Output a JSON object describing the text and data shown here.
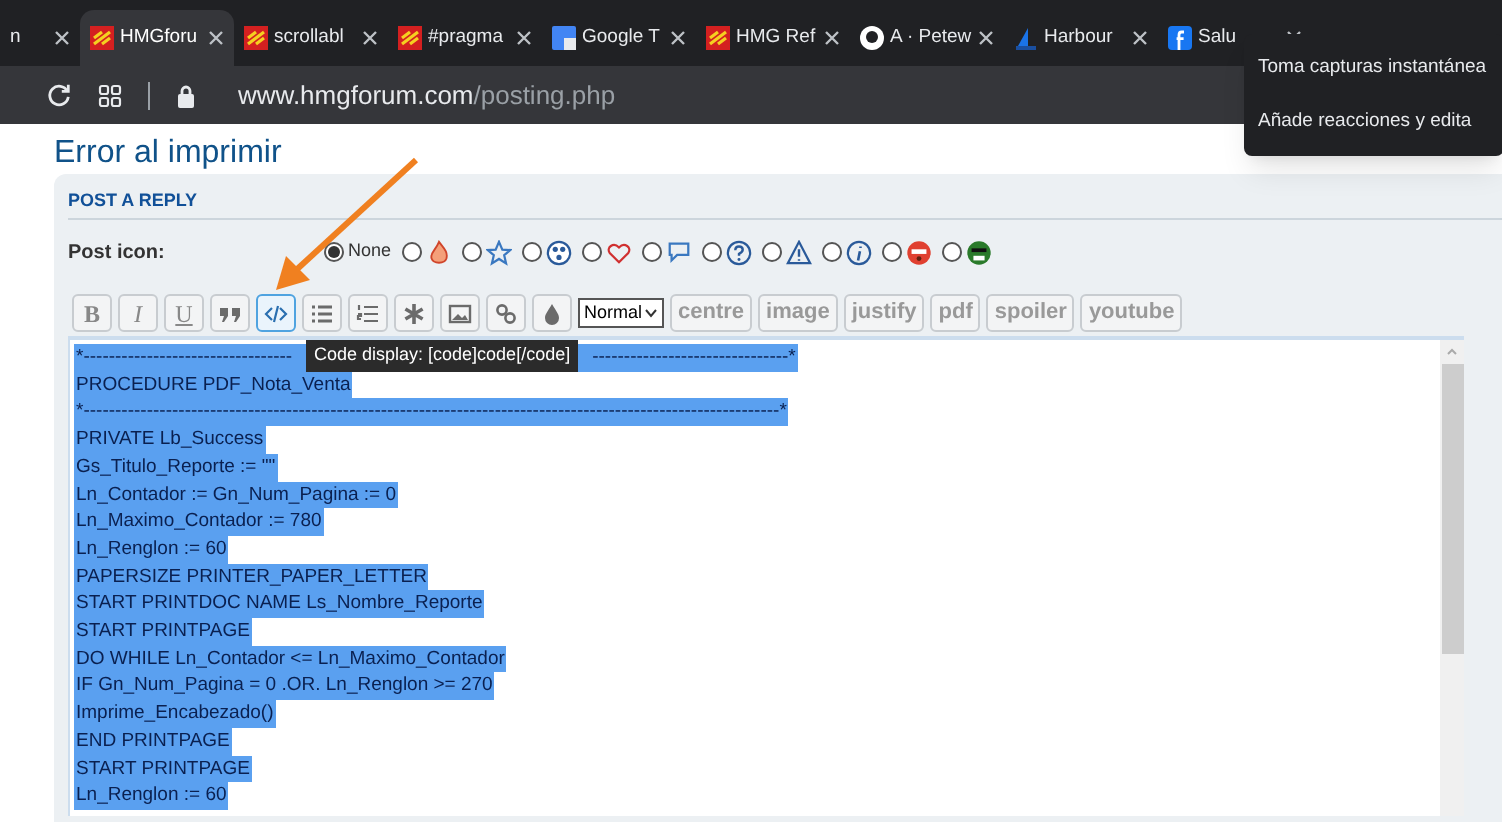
{
  "browser": {
    "tabs": [
      {
        "title": "n",
        "kind": "none",
        "selected": false
      },
      {
        "title": "HMGforu",
        "kind": "hmg",
        "selected": true
      },
      {
        "title": "scrollabl",
        "kind": "hmg",
        "selected": false
      },
      {
        "title": "#pragma",
        "kind": "hmg",
        "selected": false
      },
      {
        "title": "Google T",
        "kind": "google",
        "selected": false
      },
      {
        "title": "HMG Ref",
        "kind": "hmg",
        "selected": false
      },
      {
        "title": "A · Petew",
        "kind": "github",
        "selected": false
      },
      {
        "title": "Harbour",
        "kind": "harbour",
        "selected": false
      },
      {
        "title": "Salu",
        "kind": "facebook",
        "selected": false
      }
    ],
    "url_host": "www.hmgforum.com",
    "url_path": "/posting.php",
    "popup": [
      "Toma capturas instantánea",
      "Añade reacciones y edita"
    ]
  },
  "page": {
    "title": "Error al imprimir",
    "section": "POST A REPLY",
    "post_icon_label": "Post icon:",
    "post_icons": [
      {
        "kind": "none",
        "label": "None",
        "selected": true
      },
      {
        "kind": "fire",
        "selected": false
      },
      {
        "kind": "star",
        "selected": false
      },
      {
        "kind": "radiation",
        "selected": false
      },
      {
        "kind": "heart",
        "selected": false
      },
      {
        "kind": "speech",
        "selected": false
      },
      {
        "kind": "question",
        "selected": false
      },
      {
        "kind": "warning",
        "selected": false
      },
      {
        "kind": "info",
        "selected": false
      },
      {
        "kind": "red-face",
        "selected": false
      },
      {
        "kind": "green-face",
        "selected": false
      }
    ],
    "toolbar": [
      {
        "kind": "letter",
        "label": "B",
        "highlighted": false
      },
      {
        "kind": "letter",
        "label": "I",
        "highlighted": false
      },
      {
        "kind": "letter",
        "label": "U",
        "highlighted": false
      },
      {
        "kind": "quote",
        "highlighted": false
      },
      {
        "kind": "code",
        "highlighted": true
      },
      {
        "kind": "list",
        "highlighted": false
      },
      {
        "kind": "numbered-list",
        "highlighted": false
      },
      {
        "kind": "asterisk",
        "highlighted": false
      },
      {
        "kind": "image",
        "highlighted": false
      },
      {
        "kind": "link",
        "highlighted": false
      },
      {
        "kind": "color",
        "highlighted": false
      },
      {
        "kind": "select",
        "label": "Normal",
        "highlighted": false
      },
      {
        "kind": "word",
        "label": "centre",
        "highlighted": false
      },
      {
        "kind": "word",
        "label": "image",
        "highlighted": false
      },
      {
        "kind": "word",
        "label": "justify",
        "highlighted": false
      },
      {
        "kind": "word",
        "label": "pdf",
        "highlighted": false
      },
      {
        "kind": "word",
        "label": "spoiler",
        "highlighted": false
      },
      {
        "kind": "word",
        "label": "youtube",
        "highlighted": false
      }
    ],
    "tooltip": "Code display: [code]code[/code]",
    "code_lines": [
      [
        "*---------------------------------",
        "-------------------------------*"
      ],
      "PROCEDURE PDF_Nota_Venta",
      "*--------------------------------------------------------------------------------------------------------------*",
      "PRIVATE Lb_Success",
      "Gs_Titulo_Reporte := \"\"",
      "Ln_Contador := Gn_Num_Pagina := 0",
      "Ln_Maximo_Contador := 780",
      "Ln_Renglon := 60",
      "PAPERSIZE PRINTER_PAPER_LETTER",
      "START PRINTDOC NAME Ls_Nombre_Reporte",
      "START PRINTPAGE",
      "DO WHILE Ln_Contador <= Ln_Maximo_Contador",
      "IF Gn_Num_Pagina = 0 .OR. Ln_Renglon >= 270",
      "Imprime_Encabezado()",
      "END PRINTPAGE",
      "START PRINTPAGE",
      "Ln_Renglon := 60"
    ],
    "code_selected": true
  }
}
